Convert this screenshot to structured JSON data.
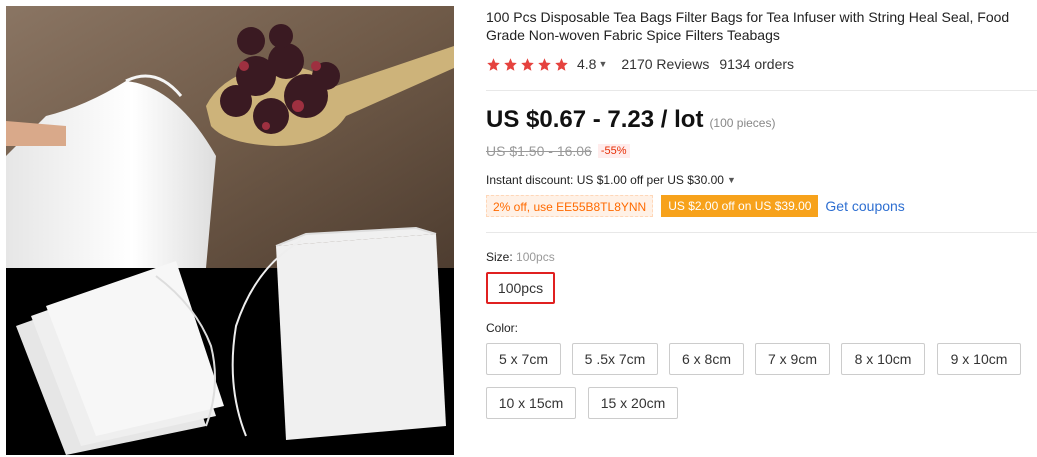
{
  "product": {
    "title": "100 Pcs Disposable Tea Bags Filter Bags for Tea Infuser with String Heal Seal, Food Grade Non-woven Fabric Spice Filters Teabags",
    "rating": "4.8",
    "reviews": "2170 Reviews",
    "orders": "9134 orders",
    "stars_filled": 5
  },
  "price": {
    "current": "US $0.67 - 7.23 / lot",
    "pieces": "(100 pieces)",
    "original": "US $1.50 - 16.06",
    "discount": "-55%"
  },
  "promo": {
    "instant_discount": "Instant discount: US $1.00 off per US $30.00",
    "code_coupon": "2% off, use EE55B8TL8YNN",
    "store_coupon": "US $2.00 off on US $39.00",
    "get_coupons": "Get coupons"
  },
  "size": {
    "label": "Size:",
    "selected": "100pcs",
    "options": [
      "100pcs"
    ]
  },
  "color": {
    "label": "Color:",
    "options": [
      "5 x 7cm",
      "5 .5x 7cm",
      "6 x 8cm",
      "7 x 9cm",
      "8 x 10cm",
      "9 x 10cm",
      "10 x 15cm",
      "15 x 20cm"
    ]
  },
  "colors": {
    "star": "#e5423e",
    "price": "#111111",
    "discount": "#e62e04",
    "coupon_orange": "#ff6a00",
    "store_coupon_bg": "#f7a21b",
    "link": "#2e6fd1",
    "selected_border": "#e02020"
  }
}
